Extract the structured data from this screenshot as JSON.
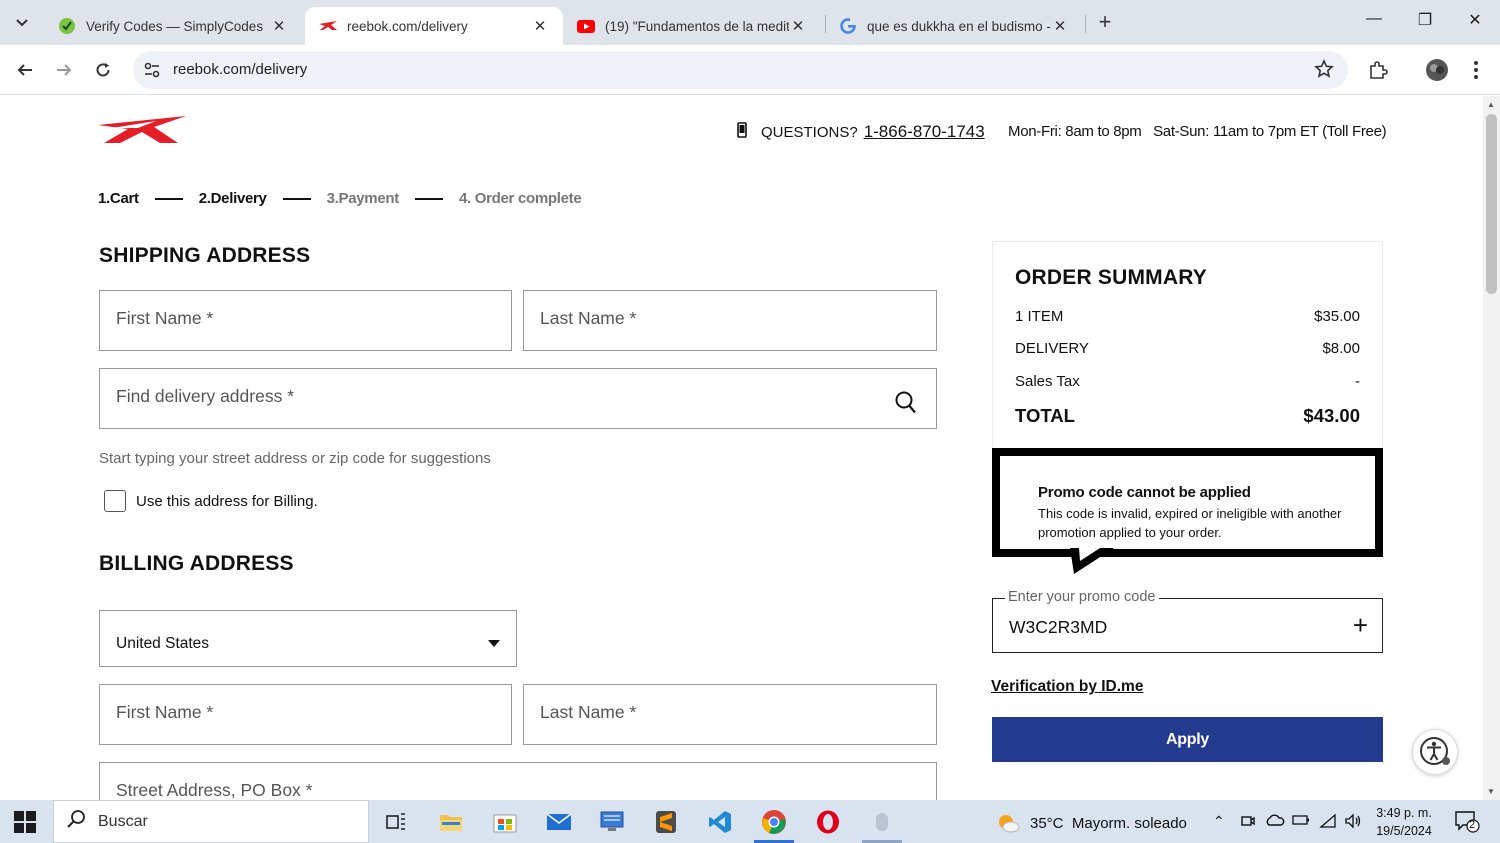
{
  "browser": {
    "tabs": [
      {
        "title": "Verify Codes — SimplyCodes",
        "icon": "simplycodes-icon"
      },
      {
        "title": "reebok.com/delivery",
        "icon": "reebok-icon"
      },
      {
        "title": "(19) \"Fundamentos de la medit",
        "icon": "youtube-icon"
      },
      {
        "title": "que es dukkha en el budismo -",
        "icon": "google-icon"
      }
    ],
    "active_tab": 1,
    "url": "reebok.com/delivery"
  },
  "header": {
    "questions_label": "QUESTIONS?",
    "phone": "1-866-870-1743",
    "hours": "Mon-Fri: 8am to 8pm   Sat-Sun: 11am to 7pm ET (Toll Free)"
  },
  "steps": [
    {
      "label": "1.Cart",
      "state": "done"
    },
    {
      "label": "2.Delivery",
      "state": "current"
    },
    {
      "label": "3.Payment",
      "state": "upcoming"
    },
    {
      "label": "4. Order complete",
      "state": "upcoming"
    }
  ],
  "shipping": {
    "title": "SHIPPING ADDRESS",
    "first_name_ph": "First Name *",
    "last_name_ph": "Last Name *",
    "address_ph": "Find delivery address *",
    "hint": "Start typing your street address or zip code for suggestions",
    "billing_checkbox_label": "Use this address for Billing.",
    "billing_checked": false
  },
  "billing": {
    "title": "BILLING ADDRESS",
    "country": "United States",
    "first_name_ph": "First Name *",
    "last_name_ph": "Last Name *",
    "street_ph": "Street Address, PO Box *"
  },
  "summary": {
    "title": "ORDER SUMMARY",
    "rows": [
      {
        "label": "1 ITEM",
        "value": "$35.00"
      },
      {
        "label": "DELIVERY",
        "value": "$8.00"
      },
      {
        "label": "Sales Tax",
        "value": "-"
      }
    ],
    "total_label": "TOTAL",
    "total_value": "$43.00"
  },
  "promo": {
    "error_title": "Promo code cannot be applied",
    "error_body": "This code is invalid, expired or ineligible with another promotion applied to your order.",
    "field_label": "Enter your promo code",
    "field_value": "W3C2R3MD",
    "verification_link": "Verification by ID.me",
    "apply_label": "Apply"
  },
  "colors": {
    "brand_red": "#e41e26",
    "apply_blue": "#233b8f"
  },
  "taskbar": {
    "search_label": "Buscar",
    "weather": "35°C  Mayorm. soleado",
    "time": "3:49 p. m.",
    "date": "19/5/2024",
    "notifications": "2"
  }
}
